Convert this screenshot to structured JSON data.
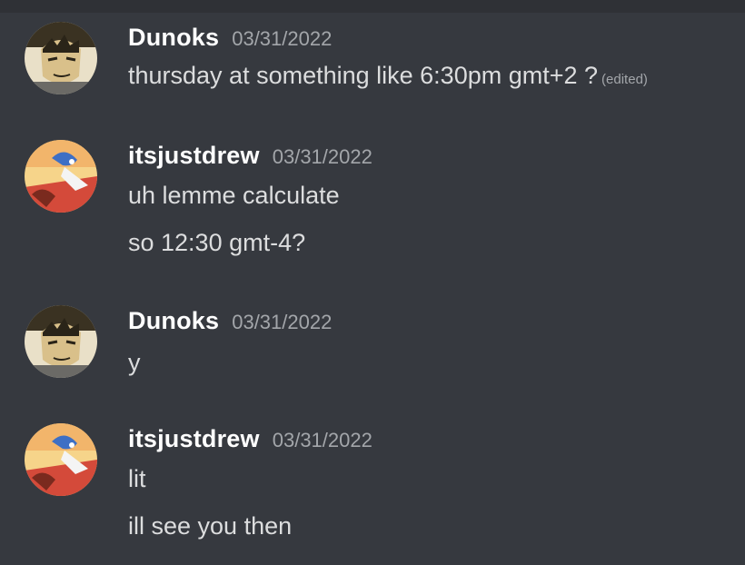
{
  "messages": [
    {
      "author": "Dunoks",
      "timestamp": "03/31/2022",
      "avatar": "dunoks-avatar",
      "lines": [
        "thursday at something like 6:30pm gmt+2 ?"
      ],
      "edited_label": "(edited)"
    },
    {
      "author": "itsjustdrew",
      "timestamp": "03/31/2022",
      "avatar": "itsjustdrew-avatar",
      "lines": [
        "uh lemme calculate",
        "so 12:30 gmt-4?"
      ]
    },
    {
      "author": "Dunoks",
      "timestamp": "03/31/2022",
      "avatar": "dunoks-avatar",
      "lines": [
        "y"
      ]
    },
    {
      "author": "itsjustdrew",
      "timestamp": "03/31/2022",
      "avatar": "itsjustdrew-avatar",
      "lines": [
        "lit",
        "ill see you then"
      ]
    }
  ],
  "colors": {
    "background": "#36393f",
    "username": "#ffffff",
    "text": "#dcddde",
    "muted": "#a3a6aa"
  }
}
